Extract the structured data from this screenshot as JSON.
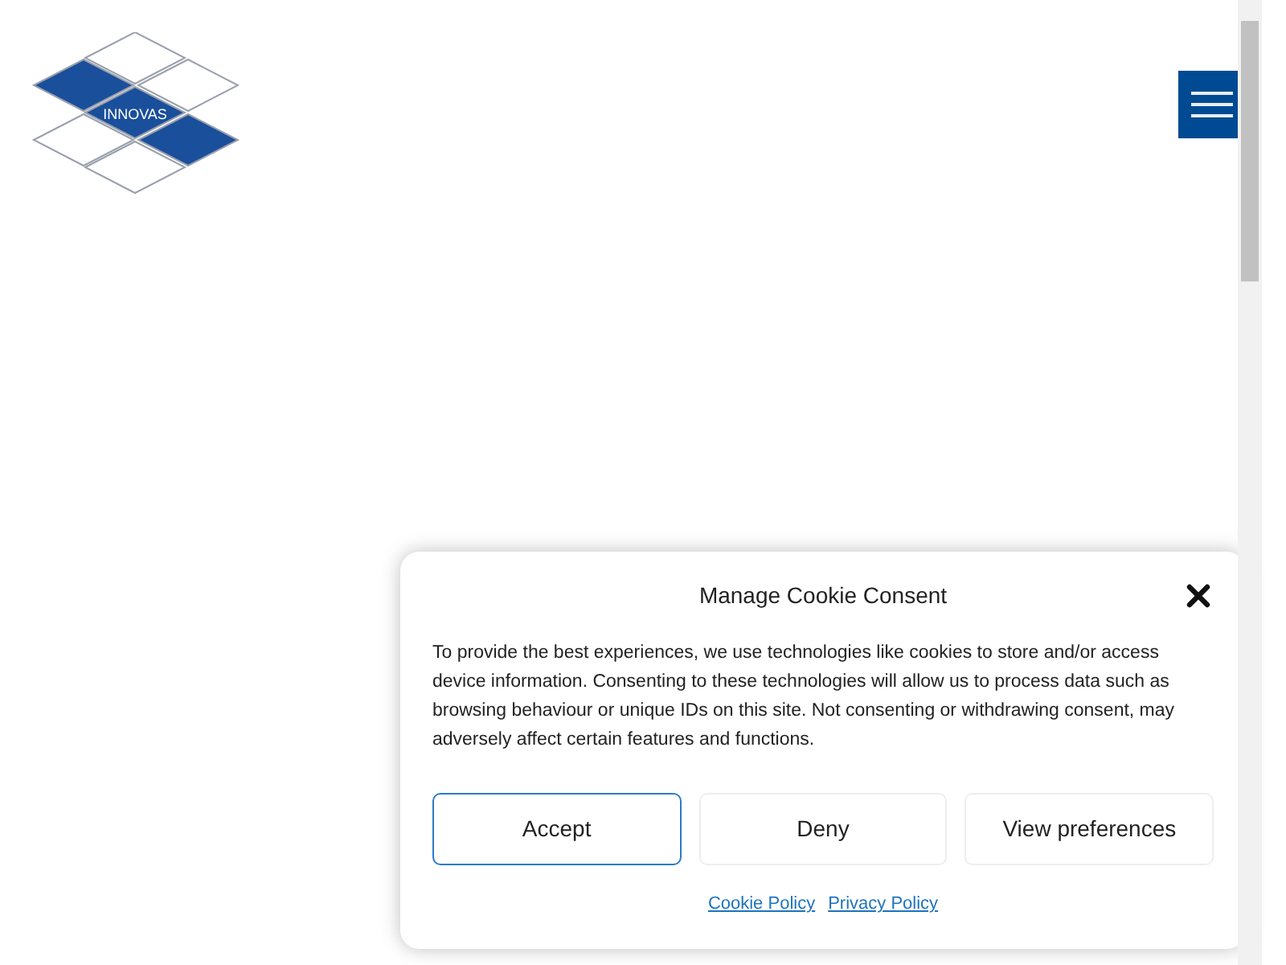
{
  "logo": {
    "text": "INNOVAS"
  },
  "cookie_dialog": {
    "title": "Manage Cookie Consent",
    "message": "To provide the best experiences, we use technologies like cookies to store and/or access device information. Consenting to these technologies will allow us to process data such as browsing behaviour or unique IDs on this site. Not consenting or withdrawing consent, may adversely affect certain features and functions.",
    "buttons": [
      {
        "label": "Accept",
        "kind": "primary"
      },
      {
        "label": "Deny",
        "kind": "secondary"
      },
      {
        "label": "View preferences",
        "kind": "secondary"
      }
    ],
    "links": [
      "Cookie Policy",
      "Privacy Policy"
    ]
  }
}
